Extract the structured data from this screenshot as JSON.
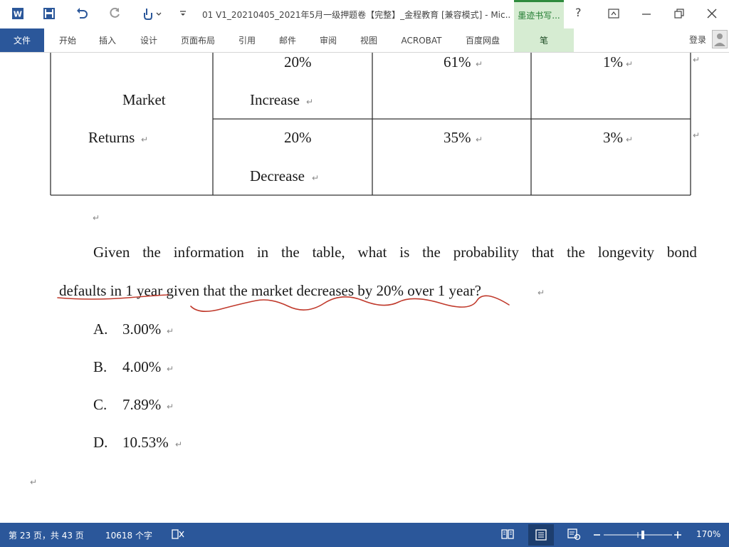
{
  "titlebar": {
    "title": "01 V1_20210405_2021年5月一级押题卷【完整】_金程教育 [兼容模式] - Mic...",
    "ink_tab": "墨迹书写...",
    "help": "?"
  },
  "ribbon": {
    "tabs": [
      "文件",
      "开始",
      "插入",
      "设计",
      "页面布局",
      "引用",
      "邮件",
      "审阅",
      "视图",
      "ACROBAT",
      "百度网盘",
      "笔"
    ],
    "login": "登录"
  },
  "table": {
    "row_header_line1": "Market",
    "row_header_line2": "Returns",
    "rows": [
      {
        "label_top": "20%",
        "label_bottom": "Increase",
        "c1": "61%",
        "c2": "1%"
      },
      {
        "label_top": "20%",
        "label_bottom": "Decrease",
        "c1": "35%",
        "c2": "3%"
      }
    ]
  },
  "question": {
    "line1_words": [
      "Given",
      "the",
      "information",
      "in",
      "the",
      "table,",
      "what",
      "is",
      "the",
      "probability",
      "that",
      "the",
      "longevity",
      "bond"
    ],
    "line2": "defaults in 1 year given that the market decreases by 20% over 1 year?",
    "options": [
      {
        "letter": "A.",
        "text": "3.00%"
      },
      {
        "letter": "B.",
        "text": "4.00%"
      },
      {
        "letter": "C.",
        "text": "7.89%"
      },
      {
        "letter": "D.",
        "text": "10.53%"
      }
    ]
  },
  "marks": {
    "para": "↵"
  },
  "status": {
    "page": "第 23 页，共 43 页",
    "words": "10618 个字",
    "zoom": "170%"
  },
  "colors": {
    "accent": "#2b579a",
    "annotation": "#c0392b",
    "ink_tab": "#d6ecd2"
  }
}
